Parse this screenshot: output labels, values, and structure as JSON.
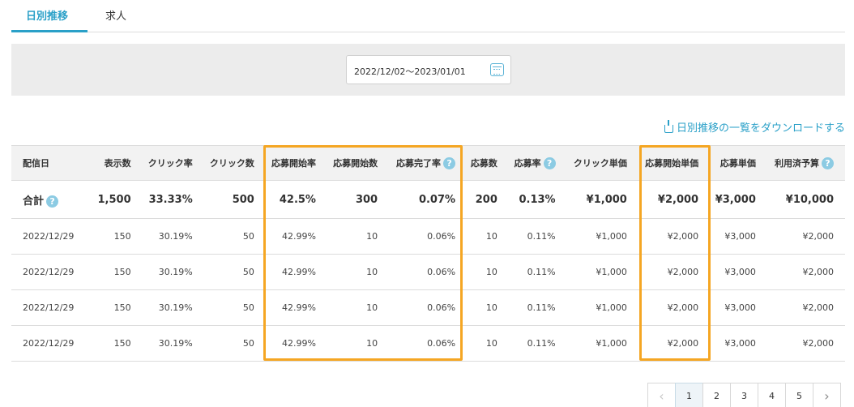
{
  "tabs": [
    {
      "label": "日別推移",
      "active": true
    },
    {
      "label": "求人",
      "active": false
    }
  ],
  "filter": {
    "date_range": "2022/12/02〜2023/01/01",
    "icon": "calendar-icon"
  },
  "download_link": "日別推移の一覧をダウンロードする",
  "table": {
    "headers": [
      "配信日",
      "表示数",
      "クリック率",
      "クリック数",
      "応募開始率",
      "応募開始数",
      "応募完了率",
      "応募数",
      "応募率",
      "クリック単価",
      "応募開始単価",
      "応募単価",
      "利用済予算"
    ],
    "help_icons_on": [
      "応募完了率",
      "応募率",
      "利用済予算"
    ],
    "total": {
      "label": "合計",
      "values": [
        "1,500",
        "33.33%",
        "500",
        "42.5%",
        "300",
        "0.07%",
        "200",
        "0.13%",
        "¥1,000",
        "¥2,000",
        "¥3,000",
        "¥10,000"
      ]
    },
    "rows": [
      [
        "2022/12/29",
        "150",
        "30.19%",
        "50",
        "42.99%",
        "10",
        "0.06%",
        "10",
        "0.11%",
        "¥1,000",
        "¥2,000",
        "¥3,000",
        "¥2,000"
      ],
      [
        "2022/12/29",
        "150",
        "30.19%",
        "50",
        "42.99%",
        "10",
        "0.06%",
        "10",
        "0.11%",
        "¥1,000",
        "¥2,000",
        "¥3,000",
        "¥2,000"
      ],
      [
        "2022/12/29",
        "150",
        "30.19%",
        "50",
        "42.99%",
        "10",
        "0.06%",
        "10",
        "0.11%",
        "¥1,000",
        "¥2,000",
        "¥3,000",
        "¥2,000"
      ],
      [
        "2022/12/29",
        "150",
        "30.19%",
        "50",
        "42.99%",
        "10",
        "0.06%",
        "10",
        "0.11%",
        "¥1,000",
        "¥2,000",
        "¥3,000",
        "¥2,000"
      ]
    ]
  },
  "pagination": {
    "prev": "‹",
    "pages": [
      "1",
      "2",
      "3",
      "4",
      "5"
    ],
    "current": "1",
    "next": "›"
  },
  "colors": {
    "accent": "#2aa0c8",
    "highlight": "#f5a623",
    "help_icon": "#8ccbe3"
  }
}
